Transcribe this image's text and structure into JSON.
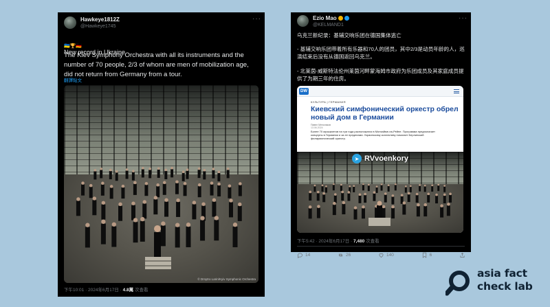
{
  "colors": {
    "background": "#a9c8dd",
    "card": "#000000",
    "text": "#e7e9ea",
    "muted": "#71767b",
    "link": "#1d9bf0",
    "article_title": "#1a4b9c",
    "brand_text": "#0f2233"
  },
  "left_tweet": {
    "display_name": "Hawkeye1812Z",
    "handle": "@Hawkeye1745",
    "more_icon": "more-dots-icon",
    "emoji_prefix": "🇺🇦🏆🇩🇪",
    "line1": "New record in Ukraine",
    "body": "The Kiev Symphony Orchestra with all its instruments and the number of 70 people, 2/3 of whom are men of mobilization age, did not return from Germany from a tour.",
    "translate_link": "翻譯貼文",
    "photo_credit": "© Dmytro Larin/Kyiv Symphonic Orchestra",
    "timestamp": "下午10:01 · 2024年6月17日 · ",
    "views_count": "4.8萬",
    "views_label": " 次查看"
  },
  "right_tweet": {
    "display_name": "Ezio Mao",
    "handle": "@KELMAND1",
    "badge_icons": [
      "emoji-icon",
      "verified-badge-icon"
    ],
    "more_icon": "more-dots-icon",
    "line1": "乌克兰新纪录：基辅交响乐团在德国集体逃亡",
    "line2": "- 基辅交响乐团带着所有乐器和70人的团员，其中2/3是动员年龄的人，巡演结束后没有从德国返回乌克兰。",
    "line3": "- 北莱茵-威斯特法伦州莱茵河畔蒙海姆市政府为乐团成员及其家庭成员提供了为期三年的住房。",
    "article": {
      "logo": "DW",
      "section": "КУЛЬТУРА | ГЕРМАНИЯ",
      "title": "Киевский симфонический оркестр обрел новый дом в Германии",
      "author": "Павел Мельников",
      "date": "13.06.2024",
      "body": "Более 70 музыкантов на три года расположатся в Монхайме-на-Рейне. Программа предполагает концерты в Германии и за ее пределами. Украинскому коллективу помогает Берлинский филармонический оркестр.",
      "watermark": "RVvoenkory"
    },
    "timestamp": "下午5:42 · 2024年6月17日 · ",
    "views_count": "7,480",
    "views_label": " 次查看",
    "actions": {
      "reply_count": "14",
      "retweet_count": "26",
      "like_count": "140",
      "bookmark_count": "6"
    }
  },
  "brand": {
    "line1": "asia fact",
    "line2": "check lab"
  }
}
